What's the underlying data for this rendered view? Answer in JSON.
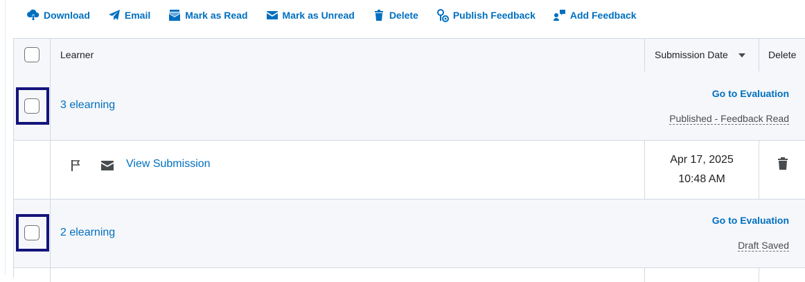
{
  "toolbar": {
    "download": "Download",
    "email": "Email",
    "mark_read": "Mark as Read",
    "mark_unread": "Mark as Unread",
    "delete": "Delete",
    "publish": "Publish Feedback",
    "add_feedback": "Add Feedback"
  },
  "table": {
    "col_learner": "Learner",
    "col_submission_date": "Submission Date",
    "col_delete": "Delete"
  },
  "learners": [
    {
      "name": "3 elearning",
      "go_eval": "Go to Evaluation",
      "status": "Published - Feedback Read",
      "submission": {
        "link": "View Submission",
        "date": "Apr 17, 2025",
        "time": "10:48 AM"
      }
    },
    {
      "name": "2 elearning",
      "go_eval": "Go to Evaluation",
      "status": "Draft Saved"
    }
  ],
  "colors": {
    "link": "#006fbf",
    "highlight": "#14147a"
  }
}
